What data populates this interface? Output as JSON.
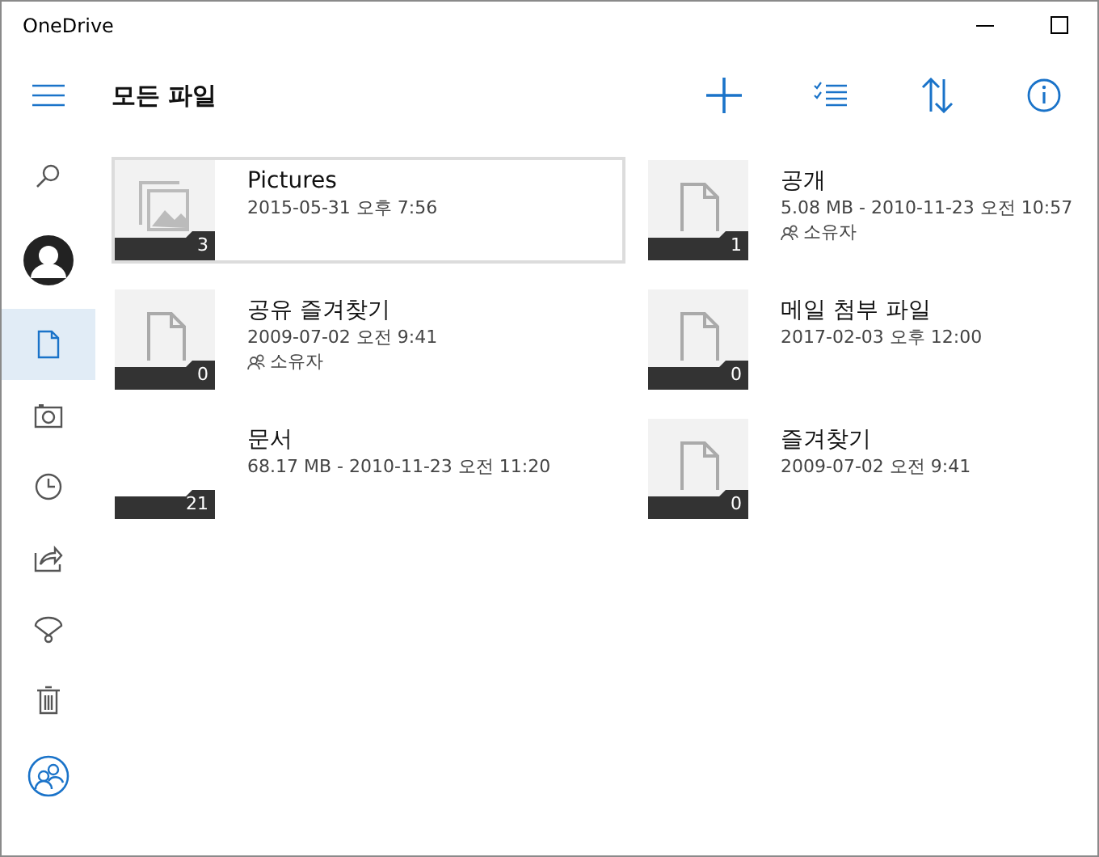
{
  "window": {
    "title": "OneDrive"
  },
  "sidebar": {
    "items": [
      {
        "kind": "search",
        "selected": false
      },
      {
        "kind": "account",
        "selected": false
      },
      {
        "kind": "files",
        "selected": true
      },
      {
        "kind": "photos",
        "selected": false
      },
      {
        "kind": "recent",
        "selected": false
      },
      {
        "kind": "shared",
        "selected": false
      },
      {
        "kind": "offline",
        "selected": false
      },
      {
        "kind": "trash",
        "selected": false
      },
      {
        "kind": "people",
        "selected": false
      }
    ]
  },
  "header": {
    "title": "모든 파일",
    "actions": [
      {
        "kind": "add"
      },
      {
        "kind": "select"
      },
      {
        "kind": "sort"
      },
      {
        "kind": "info"
      }
    ]
  },
  "files": [
    {
      "kind": "pictures",
      "name": "Pictures",
      "meta": "2015-05-31 오후 7:56",
      "count": "3",
      "selected": true
    },
    {
      "kind": "doc",
      "name": "공개",
      "meta": "5.08 MB - 2010-11-23 오전 10:57",
      "owner": "소유자",
      "count": "1",
      "selected": false
    },
    {
      "kind": "doc",
      "name": "공유 즐겨찾기",
      "meta": "2009-07-02 오전 9:41",
      "owner": "소유자",
      "count": "0",
      "selected": false
    },
    {
      "kind": "doc",
      "name": "메일 첨부 파일",
      "meta": "2017-02-03 오후 12:00",
      "count": "0",
      "selected": false
    },
    {
      "kind": "empty",
      "name": "문서",
      "meta": "68.17 MB - 2010-11-23 오전 11:20",
      "count": "21",
      "selected": false
    },
    {
      "kind": "doc",
      "name": "즐겨찾기",
      "meta": "2009-07-02 오전 9:41",
      "count": "0",
      "selected": false
    }
  ]
}
